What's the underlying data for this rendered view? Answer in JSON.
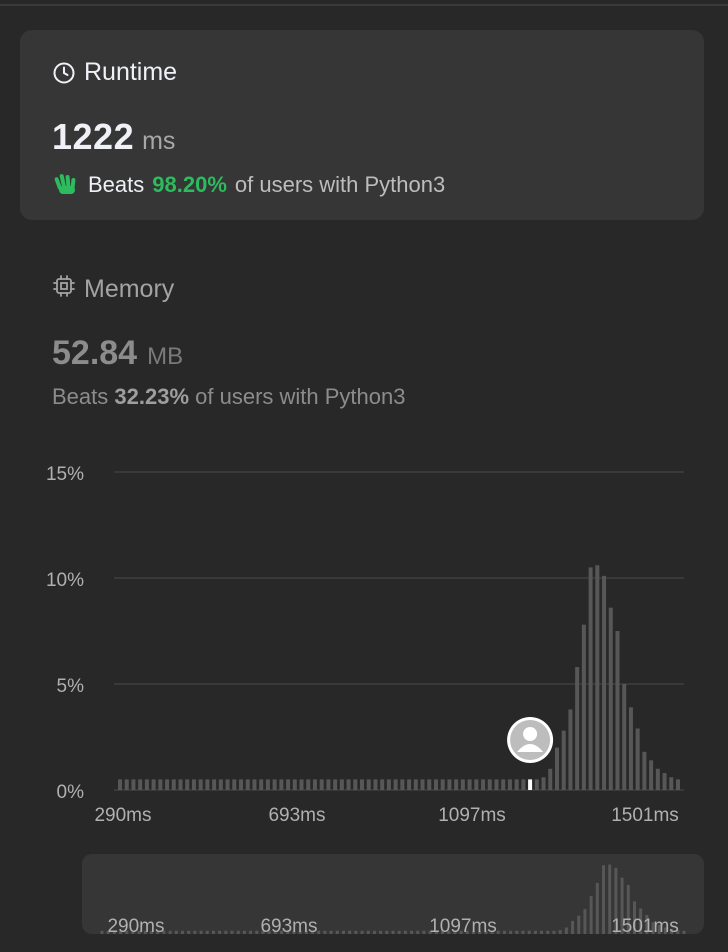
{
  "runtime": {
    "title": "Runtime",
    "value": "1222",
    "unit": "ms",
    "beats_prefix": "Beats",
    "beats_percent": "98.20%",
    "beats_suffix": "of users with Python3",
    "icon": "clock-icon",
    "accent": "#2cbb5d"
  },
  "memory": {
    "title": "Memory",
    "value": "52.84",
    "unit": "MB",
    "beats_prefix": "Beats",
    "beats_percent": "32.23%",
    "beats_suffix": "of users with Python3",
    "icon": "chip-icon"
  },
  "chart_data": {
    "type": "bar",
    "ylim": [
      0,
      15
    ],
    "y_ticks": [
      "0%",
      "5%",
      "10%",
      "15%"
    ],
    "x_tick_labels": [
      "290ms",
      "693ms",
      "1097ms",
      "1501ms"
    ],
    "grid": true,
    "user_marker_index": 61,
    "values": [
      0.5,
      0.5,
      0.5,
      0.5,
      0.5,
      0.5,
      0.5,
      0.5,
      0.5,
      0.5,
      0.5,
      0.5,
      0.5,
      0.5,
      0.5,
      0.5,
      0.5,
      0.5,
      0.5,
      0.5,
      0.5,
      0.5,
      0.5,
      0.5,
      0.5,
      0.5,
      0.5,
      0.5,
      0.5,
      0.5,
      0.5,
      0.5,
      0.5,
      0.5,
      0.5,
      0.5,
      0.5,
      0.5,
      0.5,
      0.5,
      0.5,
      0.5,
      0.5,
      0.5,
      0.5,
      0.5,
      0.5,
      0.5,
      0.5,
      0.5,
      0.5,
      0.5,
      0.5,
      0.5,
      0.5,
      0.5,
      0.5,
      0.5,
      0.5,
      0.5,
      0.5,
      0.5,
      0.5,
      0.6,
      1.0,
      2.0,
      2.8,
      3.8,
      5.8,
      7.8,
      10.5,
      10.6,
      10.1,
      8.6,
      7.5,
      5.0,
      3.9,
      2.9,
      1.8,
      1.4,
      1.0,
      0.8,
      0.6,
      0.5
    ],
    "mini_values": [
      0.5,
      0.5,
      0.5,
      0.5,
      0.5,
      0.5,
      0.5,
      0.5,
      0.5,
      0.5,
      0.5,
      0.5,
      0.5,
      0.5,
      0.5,
      0.5,
      0.5,
      0.5,
      0.5,
      0.5,
      0.5,
      0.5,
      0.5,
      0.5,
      0.5,
      0.5,
      0.5,
      0.5,
      0.5,
      0.5,
      0.5,
      0.5,
      0.5,
      0.5,
      0.5,
      0.5,
      0.5,
      0.5,
      0.5,
      0.5,
      0.5,
      0.5,
      0.5,
      0.5,
      0.5,
      0.5,
      0.5,
      0.5,
      0.5,
      0.5,
      0.5,
      0.5,
      0.5,
      0.5,
      0.5,
      0.5,
      0.5,
      0.5,
      0.5,
      0.5,
      0.5,
      0.5,
      0.5,
      0.5,
      0.5,
      0.5,
      0.5,
      0.5,
      0.5,
      0.5,
      0.5,
      0.5,
      0.5,
      0.5,
      0.6,
      1.0,
      2.0,
      2.8,
      3.8,
      5.8,
      7.8,
      10.5,
      10.6,
      10.1,
      8.6,
      7.5,
      5.0,
      3.9,
      2.9,
      1.8,
      1.4,
      1.0,
      0.8,
      0.6,
      0.5
    ]
  },
  "colors": {
    "bar": "#575757",
    "grid": "#3f3f3f",
    "axis_text": "#b0b0b0",
    "card": "#363636"
  }
}
